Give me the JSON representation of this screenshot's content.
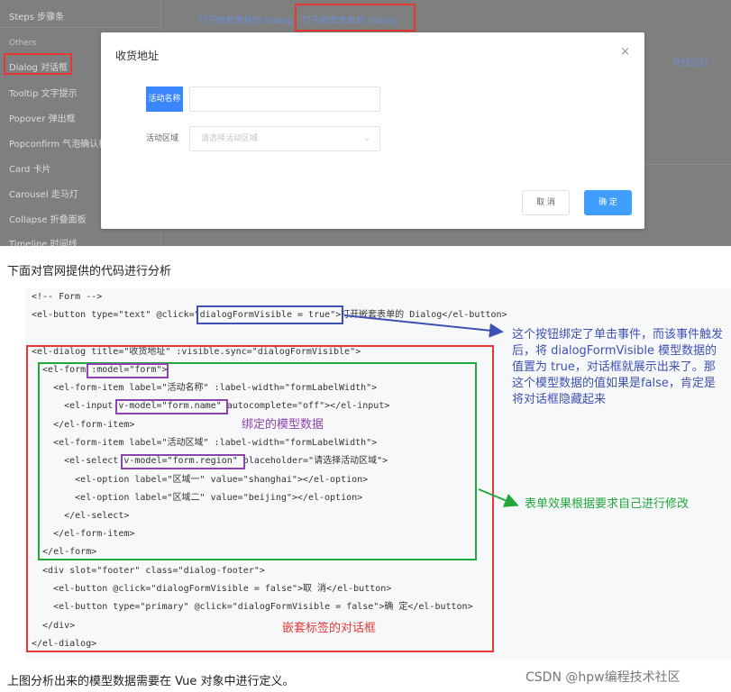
{
  "screenshot": {
    "sidebar": {
      "items": [
        "Steps 步骤条",
        "Dialog 对话框",
        "Tooltip 文字提示",
        "Popover 弹出框",
        "Popconfirm 气泡确认框",
        "Card 卡片",
        "Carousel 走马灯",
        "Collapse 折叠面板",
        "Timeline 时间线"
      ],
      "group_label": "Others"
    },
    "tabs": [
      "打开嵌套表格的 Dialog",
      "打开嵌套表单的 Dialog"
    ],
    "right_link": "在线运行",
    "dialog": {
      "title": "收货地址",
      "close_icon": "×",
      "name_label": "活动名称",
      "region_label": "活动区域",
      "region_placeholder": "请选择活动区域",
      "cancel_label": "取 消",
      "confirm_label": "确 定"
    },
    "colors": {
      "highlight": "#e53935",
      "primary": "#409eff"
    }
  },
  "intro_text": "下面对官网提供的代码进行分析",
  "code_lines": [
    "<!-- Form -->",
    "<el-button type=\"text\" @click=\"dialogFormVisible = true\">打开嵌套表单的 Dialog</el-button>",
    "",
    "<el-dialog title=\"收货地址\" :visible.sync=\"dialogFormVisible\">",
    "  <el-form :model=\"form\">",
    "    <el-form-item label=\"活动名称\" :label-width=\"formLabelWidth\">",
    "      <el-input v-model=\"form.name\" autocomplete=\"off\"></el-input>",
    "    </el-form-item>",
    "    <el-form-item label=\"活动区域\" :label-width=\"formLabelWidth\">",
    "      <el-select v-model=\"form.region\" placeholder=\"请选择活动区域\">",
    "        <el-option label=\"区域一\" value=\"shanghai\"></el-option>",
    "        <el-option label=\"区域二\" value=\"beijing\"></el-option>",
    "      </el-select>",
    "    </el-form-item>",
    "  </el-form>",
    "  <div slot=\"footer\" class=\"dialog-footer\">",
    "    <el-button @click=\"dialogFormVisible = false\">取 消</el-button>",
    "    <el-button type=\"primary\" @click=\"dialogFormVisible = false\">确 定</el-button>",
    "  </div>",
    "</el-dialog>"
  ],
  "annotations": {
    "button_note": "这个按钮绑定了单击事件，而该事件触发后，将 dialogFormVisible 模型数据的值置为 true，对话框就展示出来了。那这个模型数据的值如果是false，肯定是将对话框隐藏起来",
    "model_note": "绑定的模型数据",
    "form_note": "表单效果根据要求自己进行修改",
    "dialog_note": "嵌套标签的对话框",
    "colors": {
      "blue": "#3f51b5",
      "purple": "#8e44ad",
      "green": "#22a83a",
      "red": "#e53935"
    }
  },
  "outro_text": "上图分析出来的模型数据需要在 Vue 对象中进行定义。",
  "watermark": "CSDN @hpw编程技术社区"
}
